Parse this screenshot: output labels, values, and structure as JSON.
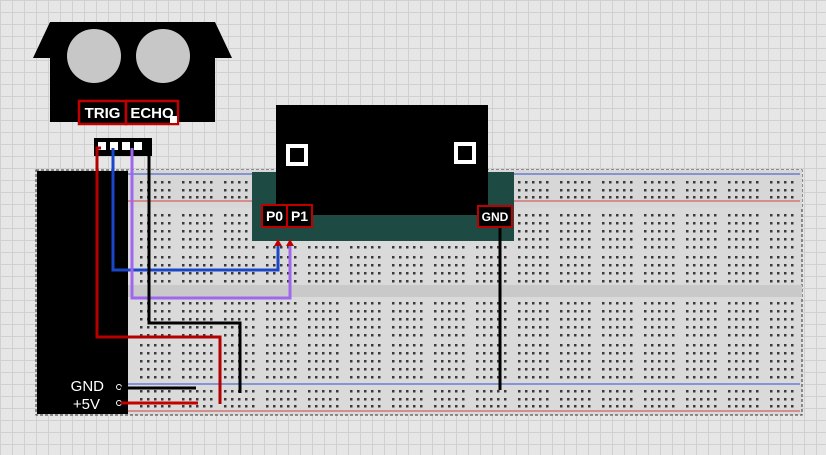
{
  "sensor": {
    "trig_label": "TRIG",
    "echo_label": "ECHO"
  },
  "module": {
    "p0_label": "P0",
    "p1_label": "P1",
    "gnd_label": "GND"
  },
  "power": {
    "gnd_label": "GND",
    "vcc_label": "+5V"
  },
  "colors": {
    "trig_wire": "#b40000",
    "echo_wire": "#1a47c9",
    "p1_wire": "#a066ee",
    "gnd_wire": "#000000",
    "vcc_wire": "#c40000",
    "breadboard": "#dadada",
    "module_base": "#1e4a44"
  }
}
